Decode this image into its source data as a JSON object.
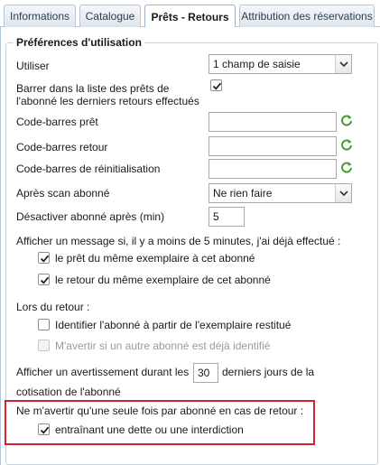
{
  "tabs": [
    {
      "label": "Informations"
    },
    {
      "label": "Catalogue"
    },
    {
      "label": "Prêts - Retours"
    },
    {
      "label": "Attribution des réservations"
    }
  ],
  "preferences": {
    "legend": "Préférences d'utilisation",
    "utiliser": {
      "label": "Utiliser",
      "value": "1 champ de saisie"
    },
    "barrer": {
      "label_line1": "Barrer dans la liste des prêts de",
      "label_line2": "l'abonné les derniers retours effectués",
      "checked": true
    },
    "codebarres_pret": {
      "label": "Code-barres prêt",
      "value": ""
    },
    "codebarres_retour": {
      "label": "Code-barres retour",
      "value": ""
    },
    "codebarres_reinit": {
      "label": "Code-barres de réinitialisation",
      "value": ""
    },
    "apres_scan": {
      "label": "Après scan abonné",
      "value": "Ne rien faire"
    },
    "desactiver": {
      "label": "Désactiver abonné après (min)",
      "value": "5"
    },
    "message_intro": "Afficher un message si, il y a moins de 5 minutes, j'ai déjà effectué :",
    "pret_meme": {
      "label": "le prêt du même exemplaire à cet abonné",
      "checked": true
    },
    "retour_meme": {
      "label": "le retour du même exemplaire de cet abonné",
      "checked": true
    },
    "lors_retour": "Lors du retour :",
    "identifier": {
      "label": "Identifier l'abonné à partir de l'exemplaire restitué",
      "checked": false
    },
    "avertir_autre": {
      "label": "M'avertir si un autre abonné est déjà identifié",
      "checked": false,
      "disabled": true
    },
    "avertissement": {
      "label_before": "Afficher un avertissement durant les",
      "days": "30",
      "label_after": "derniers jours de la",
      "label_line2": "cotisation de l'abonné"
    },
    "une_seule_fois": {
      "label": "Ne m'avertir qu'une seule fois par abonné en cas de retour :"
    },
    "dette": {
      "label": "entraînant une dette ou une interdiction",
      "checked": true
    }
  },
  "colors": {
    "highlight": "#d4232f",
    "refresh_icon": "#4a9a2a"
  }
}
